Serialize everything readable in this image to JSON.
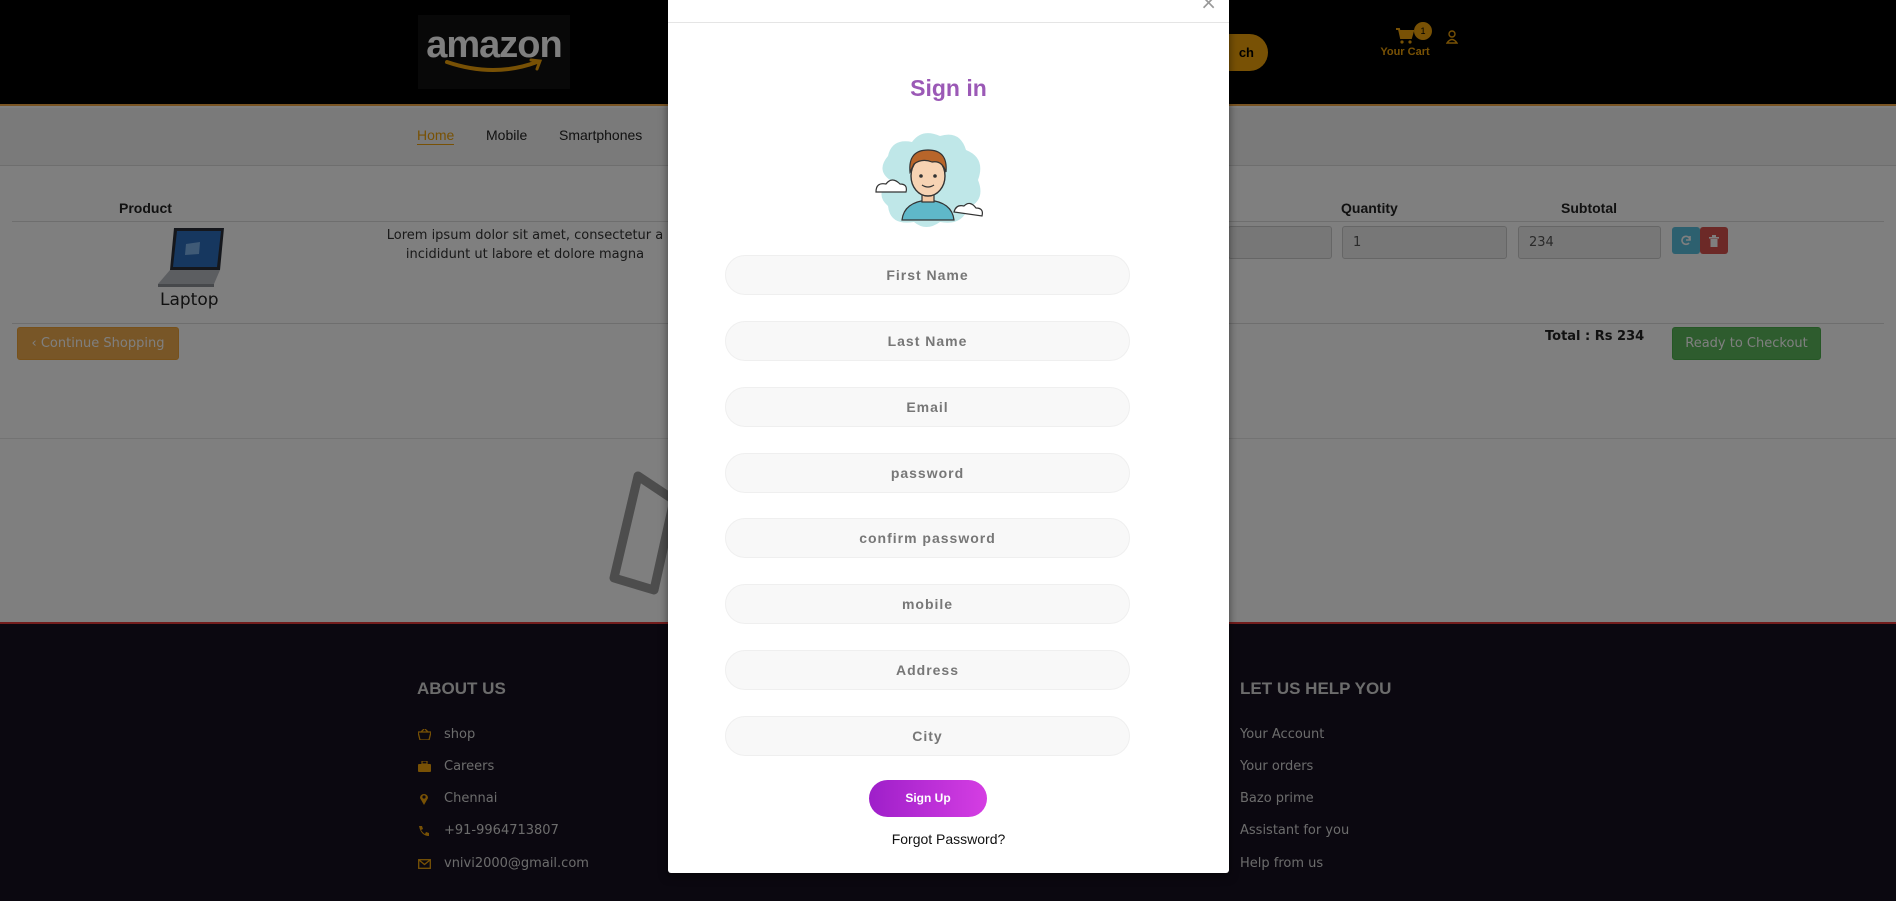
{
  "header": {
    "logo_text": "amazon",
    "search_label": "ch",
    "cart_count": "1",
    "cart_label": "Your Cart"
  },
  "nav": {
    "items": [
      "Home",
      "Mobile",
      "Smartphones"
    ]
  },
  "cart": {
    "columns": {
      "product": "Product",
      "quantity": "Quantity",
      "subtotal": "Subtotal"
    },
    "row": {
      "name": "Laptop",
      "description": "Lorem ipsum dolor sit amet, consectetur a incididunt ut labore et dolore magna",
      "quantity": "1",
      "subtotal": "234"
    },
    "continue_label": "Continue Shopping",
    "total": "Total : Rs 234",
    "checkout_label": "Ready to Checkout"
  },
  "footer": {
    "about_title": "ABOUT US",
    "about_items": [
      "shop",
      "Careers",
      "Chennai",
      "+91-9964713807",
      "vnivi2000@gmail.com"
    ],
    "help_title": "LET US HELP YOU",
    "help_items": [
      "Your Account",
      "Your orders",
      "Bazo prime",
      "Assistant for you",
      "Help from us"
    ]
  },
  "modal": {
    "close": "×",
    "title": "Sign in",
    "placeholders": {
      "first_name": "First Name",
      "last_name": "Last Name",
      "email": "Email",
      "password": "password",
      "confirm_password": "confirm password",
      "mobile": "mobile",
      "address": "Address",
      "city": "City"
    },
    "signup_label": "Sign Up",
    "forgot_label": "Forgot Password?"
  },
  "colors": {
    "accent": "#f0a30a",
    "title_purple": "#9b59b6",
    "footer_bg": "#161020",
    "checkout_green": "#5cb85c"
  }
}
